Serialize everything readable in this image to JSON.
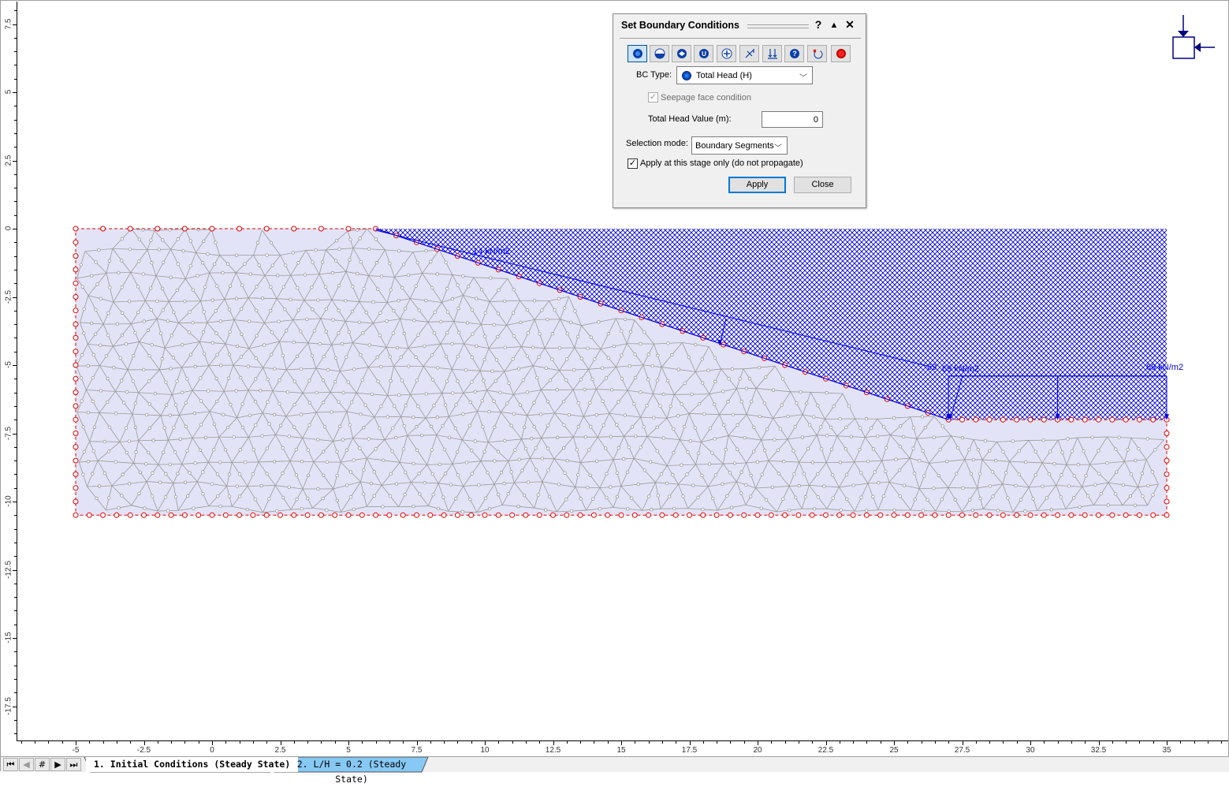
{
  "dialog": {
    "title": "Set Boundary Conditions",
    "help_label": "?",
    "collapse_label": "▲",
    "close_label": "✕",
    "toolbar": [
      {
        "name": "total-head",
        "icon": "total-head-icon",
        "active": true
      },
      {
        "name": "pressure-head",
        "icon": "pressure-head-icon",
        "active": false
      },
      {
        "name": "nodal-flow",
        "icon": "nodal-flow-icon",
        "active": false
      },
      {
        "name": "unknown-p-q",
        "icon": "unknown-icon",
        "active": false
      },
      {
        "name": "normal-flux",
        "icon": "normal-flux-icon",
        "active": false
      },
      {
        "name": "infiltration",
        "icon": "infiltration-icon",
        "active": false
      },
      {
        "name": "ponding",
        "icon": "ponding-icon",
        "active": false
      },
      {
        "name": "help",
        "icon": "help-icon",
        "active": false
      },
      {
        "name": "reset",
        "icon": "reset-icon",
        "active": false
      },
      {
        "name": "stop",
        "icon": "record-icon",
        "active": false
      }
    ],
    "bc_type_label": "BC Type:",
    "bc_type_value": "Total Head (H)",
    "seepage_label": "Seepage face condition",
    "seepage_checked": true,
    "seepage_disabled": true,
    "head_value_label": "Total Head Value (m):",
    "head_value": "0",
    "selection_mode_label": "Selection mode:",
    "selection_mode_value": "Boundary Segments",
    "apply_stage_label": "Apply at this stage only (do not propagate)",
    "apply_stage_checked": true,
    "apply_button": "Apply",
    "close_button": "Close"
  },
  "model": {
    "load_labels": [
      "14 kN/m2",
      "69",
      "69 kN/m2",
      "69 kN/m2"
    ],
    "colors": {
      "mesh_fill": "#e3e3f7",
      "mesh_line": "#9a9a9a",
      "boundary": "#e00000",
      "load": "#0000e0",
      "symbol": "#00007f"
    },
    "geometry_m": {
      "crest": [
        [
          -5,
          0
        ],
        [
          6,
          0
        ]
      ],
      "slope": [
        [
          6,
          0
        ],
        [
          27,
          -7
        ]
      ],
      "toe": [
        [
          27,
          -7
        ],
        [
          35,
          -7
        ]
      ],
      "base": [
        [
          -5,
          -10.5
        ],
        [
          35,
          -10.5
        ]
      ],
      "left": [
        [
          -5,
          0
        ],
        [
          -5,
          -10.5
        ]
      ],
      "right": [
        [
          35,
          -7
        ],
        [
          35,
          -10.5
        ]
      ]
    }
  },
  "axes": {
    "x_ticks": [
      "-5",
      "-2.5",
      "0",
      "2.5",
      "5",
      "7.5",
      "10",
      "12.5",
      "15",
      "17.5",
      "20",
      "22.5",
      "25",
      "27.5",
      "30",
      "32.5",
      "35"
    ],
    "y_ticks": [
      "7.5",
      "5",
      "2.5",
      "0",
      "-2.5",
      "-5",
      "-7.5",
      "-10",
      "-12.5",
      "-15",
      "-17.5"
    ]
  },
  "stage_tabs": {
    "nav": [
      "⏮",
      "◀",
      "#",
      "▶",
      "⏭"
    ],
    "tabs": [
      {
        "label": "1. Initial Conditions (Steady State)",
        "active": true
      },
      {
        "label": "2. L/H = 0.2 (Steady State)",
        "active": false
      }
    ]
  }
}
